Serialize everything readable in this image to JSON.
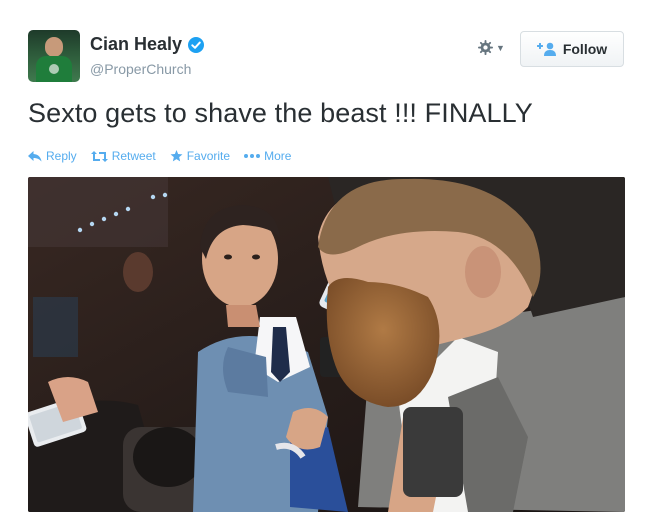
{
  "tweet": {
    "author": {
      "display_name": "Cian Healy",
      "handle": "@ProperChurch",
      "verified": true
    },
    "follow_label": "Follow",
    "text": "Sexto gets to shave the beast !!! FINALLY",
    "actions": [
      {
        "icon": "reply-icon",
        "label": "Reply"
      },
      {
        "icon": "retweet-icon",
        "label": "Retweet"
      },
      {
        "icon": "star-icon",
        "label": "Favorite"
      },
      {
        "icon": "more-dots-icon",
        "label": "More"
      }
    ]
  },
  "colors": {
    "accent": "#55acee",
    "verified_badge": "#1da1f2",
    "text_primary": "#292f33",
    "text_secondary": "#8899a6"
  }
}
